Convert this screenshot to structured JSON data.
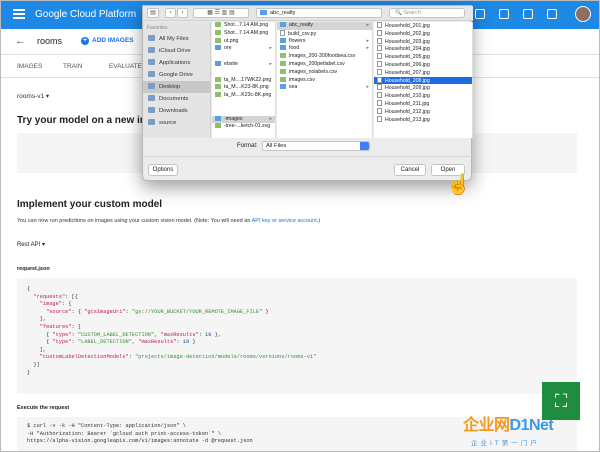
{
  "gcp": {
    "brand": "Google Cloud Platform"
  },
  "header": {
    "back_label": "←",
    "crumb": "rooms",
    "add_images": "ADD IMAGES",
    "add_plus": "+"
  },
  "tabs": [
    "IMAGES",
    "TRAIN",
    "EVALUATE"
  ],
  "model_select": "rooms-v1 ▾",
  "try_title": "Try your model on a new image",
  "impl": {
    "title": "Implement your custom model",
    "text_before": "You can now run predictions on images using your custom vision model. (Note: You will need an ",
    "link": "API key or service account",
    "text_after": ".)"
  },
  "api_select": "Rest API ▾",
  "request_label": "request.json",
  "execute_label": "Execute the request",
  "code": {
    "l1": "{",
    "l2a": "  \"requests\"",
    "l2b": ": [{",
    "l3a": "    \"image\"",
    "l3b": ": {",
    "l4a": "      \"source\"",
    "l4b": ": { ",
    "l4c": "\"gcsImageUri\"",
    "l4d": ": ",
    "l4e": "\"gs://YOUR_BUCKET/YOUR_REMOTE_IMAGE_FILE\"",
    "l4f": " }",
    "l5": "    },",
    "l6a": "    \"features\"",
    "l6b": ": [",
    "l7a": "      { ",
    "l7b": "\"type\"",
    "l7c": ": ",
    "l7d": "\"CUSTOM_LABEL_DETECTION\"",
    "l7e": ", ",
    "l7f": "\"maxResults\"",
    "l7g": ": ",
    "l7h": "10",
    "l7i": " },",
    "l8a": "      { ",
    "l8b": "\"type\"",
    "l8c": ": ",
    "l8d": "\"LABEL_DETECTION\"",
    "l8e": ", ",
    "l8f": "\"maxResults\"",
    "l8g": ": ",
    "l8h": "10",
    "l8i": " }",
    "l9": "    ],",
    "l10a": "    \"customLabelDetectionModels\"",
    "l10b": ": ",
    "l10c": "\"projects/image-detection/models/rooms/versions/rooms-v1\"",
    "l11": "  }]",
    "l12": "}"
  },
  "exec": {
    "l1": "$ curl -v -k -H \"Content-Type: application/json\" \\",
    "l2": "-H \"Authorization: Bearer `gcloud auth print-access-token`\" \\",
    "l3": "https://alpha-vision.googleapis.com/v1/images:annotate -d @request.json"
  },
  "dialog": {
    "path": "abc_realty",
    "search": "Search",
    "favorites_label": "Favorites",
    "sidebar": [
      "All My Files",
      "iCloud Drive",
      "Applications",
      "Google Drive",
      "Desktop",
      "Documents",
      "Downloads",
      "source"
    ],
    "col1": [
      "Shot...7.14 AM.png",
      "Shot...7.14 AM.png",
      "ut.png",
      "ore",
      "",
      "ebsite",
      "",
      "ta_M....17WK22.png",
      "ta_M....K23-8K.png",
      "ta_M....K23c-8K.png",
      "",
      "",
      "-images",
      "-tree-...ketch-01.svg"
    ],
    "col2": [
      "abc_realty",
      "build_csv.py",
      "flowers",
      "food",
      "images_200-300foodsea.csv",
      "images_200petlabel.csv",
      "images_nolabels.csv",
      "images.csv",
      "sea"
    ],
    "col3": [
      "Household_201.jpg",
      "Household_202.jpg",
      "Household_203.jpg",
      "Household_204.jpg",
      "Household_205.jpg",
      "Household_206.jpg",
      "Household_207.jpg",
      "Household_208.jpg",
      "Household_209.jpg",
      "Household_210.jpg",
      "Household_211.jpg",
      "Household_212.jpg",
      "Household_213.jpg"
    ],
    "format_label": "Format:",
    "format_value": "All Files",
    "options": "Options",
    "cancel": "Cancel",
    "open": "Open"
  },
  "watermark": {
    "main_a": "企业网",
    "main_b": "D1Net",
    "sub": "企业IT第一门户"
  }
}
